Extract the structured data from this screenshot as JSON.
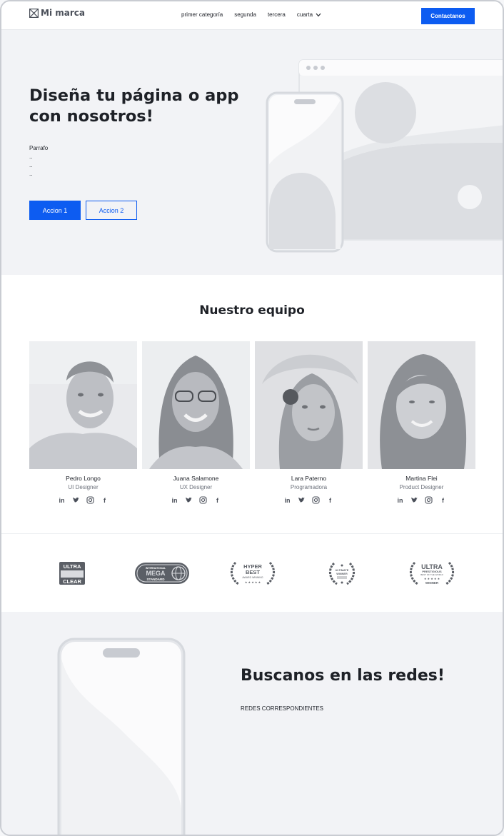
{
  "header": {
    "brand": "Mi marca",
    "nav": [
      {
        "label": "primer categoría"
      },
      {
        "label": "segunda"
      },
      {
        "label": "tercera"
      },
      {
        "label": "cuarta"
      }
    ],
    "contact_label": "Contactanos"
  },
  "hero": {
    "title": "Diseña tu página o app con nosotros!",
    "paragraph": "Parrafo\n..\n..\n..",
    "action1": "Accion 1",
    "action2": "Accion 2"
  },
  "team": {
    "title": "Nuestro equipo",
    "members": [
      {
        "name": "Pedro Longo",
        "role": "UI Designer"
      },
      {
        "name": "Juana Salamone",
        "role": "UX Designer"
      },
      {
        "name": "Lara Paterno",
        "role": "Programadora"
      },
      {
        "name": "Martina Flei",
        "role": "Product Designer"
      }
    ],
    "social_icons": [
      "linkedin-icon",
      "twitter-icon",
      "instagram-icon",
      "facebook-icon"
    ]
  },
  "awards": [
    {
      "name": "ULTRA CLEAR",
      "lines": [
        "ULTRA",
        "CLEAR"
      ]
    },
    {
      "name": "INTERNATIONAL MEGA STANDARD",
      "lines": [
        "INTERNATIONAL",
        "MEGA",
        "STANDARD"
      ]
    },
    {
      "name": "HYPER BEST AWARD WINNING",
      "lines": [
        "HYPER",
        "BEST",
        "AWARD WINNING"
      ]
    },
    {
      "name": "ULTIMATE WINNER",
      "lines": [
        "ULTIMATE",
        "WINNER"
      ]
    },
    {
      "name": "ULTRA PRESTIGIOUS BEST OF THE WORLD WINNER",
      "lines": [
        "ULTRA",
        "PRESTIGIOUS",
        "BEST OF THE WORLD",
        "WINNER"
      ]
    }
  ],
  "bottom": {
    "title": "Buscanos en las redes!",
    "subtitle": "REDES CORRESPONDIENTES"
  },
  "colors": {
    "accent": "#0d5cf1",
    "hero_bg": "#f2f3f6",
    "placeholder": "#d8dadf"
  }
}
